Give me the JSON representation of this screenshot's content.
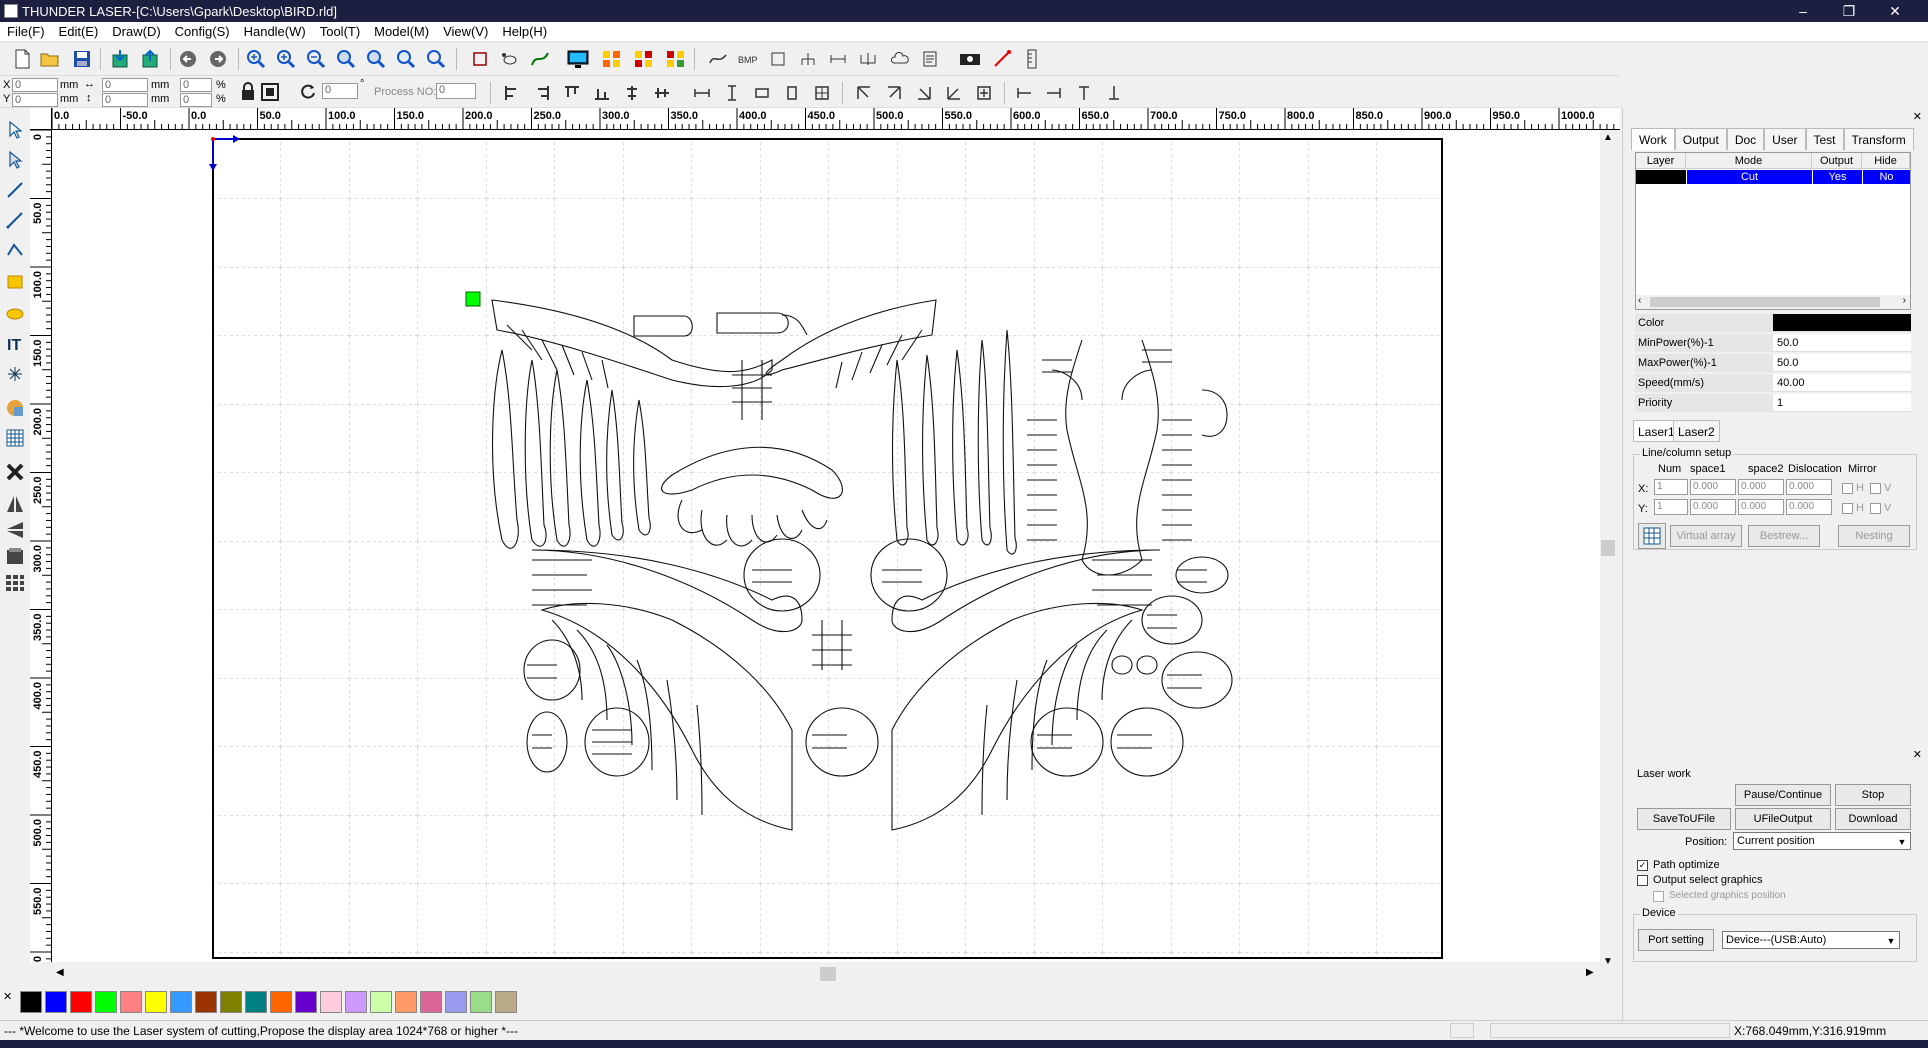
{
  "window": {
    "title": "THUNDER LASER-[C:\\Users\\Gpark\\Desktop\\BIRD.rld]",
    "min": "–",
    "max": "❐",
    "close": "✕"
  },
  "menu": [
    "File(F)",
    "Edit(E)",
    "Draw(D)",
    "Config(S)",
    "Handle(W)",
    "Tool(T)",
    "Model(M)",
    "View(V)",
    "Help(H)"
  ],
  "coords": {
    "x_label": "X",
    "y_label": "Y",
    "x_value": "0",
    "y_value": "0",
    "w_value": "0",
    "h_value": "0",
    "unit": "mm",
    "px_value": "0",
    "py_value": "0",
    "percent": "%",
    "rotate_value": "0",
    "degree": "°",
    "process_no_label": "Process NO:",
    "process_no_value": "0"
  },
  "ruler_h": [
    "0.0",
    "-50.0",
    "0.0",
    "50.0",
    "100.0",
    "150.0",
    "200.0",
    "250.0",
    "300.0",
    "350.0",
    "400.0",
    "450.0",
    "500.0",
    "550.0",
    "600.0",
    "650.0",
    "700.0",
    "750.0",
    "800.0",
    "850.0",
    "900.0",
    "950.0",
    "1000.0"
  ],
  "ruler_v": [
    "0",
    "50.0",
    "100.0",
    "150.0",
    "200.0",
    "250.0",
    "300.0",
    "350.0",
    "400.0",
    "450.0",
    "500.0",
    "550.0",
    "600.0"
  ],
  "panel": {
    "tabs": [
      "Work",
      "Output",
      "Doc",
      "User",
      "Test",
      "Transform"
    ],
    "layer_headers": [
      "Layer",
      "Mode",
      "Output",
      "Hide"
    ],
    "layer_row": {
      "mode": "Cut",
      "output": "Yes",
      "hide": "No"
    },
    "properties": [
      {
        "label": "Color",
        "value": ""
      },
      {
        "label": "MinPower(%)-1",
        "value": "50.0"
      },
      {
        "label": "MaxPower(%)-1",
        "value": "50.0"
      },
      {
        "label": "Speed(mm/s)",
        "value": "40.00"
      },
      {
        "label": "Priority",
        "value": "1"
      }
    ],
    "laser_tabs": [
      "Laser1",
      "Laser2"
    ],
    "array": {
      "title": "Line/column setup",
      "headers": [
        "Num",
        "space1",
        "space2",
        "Dislocation",
        "Mirror"
      ],
      "x_label": "X:",
      "y_label": "Y:",
      "num": "1",
      "space": "0.000",
      "h": "H",
      "v": "V",
      "virtual_array": "Virtual array",
      "bestrew": "Bestrew...",
      "nesting": "Nesting"
    },
    "laser_work": {
      "title": "Laser work",
      "pause": "Pause/Continue",
      "stop": "Stop",
      "save_to_file": "SaveToUFile",
      "ufile_output": "UFileOutput",
      "download": "Download",
      "position_label": "Position:",
      "position_value": "Current position",
      "path_optimize": "Path optimize",
      "output_select": "Output select graphics",
      "selected_position": "Selected graphics position"
    },
    "device": {
      "title": "Device",
      "port_setting": "Port setting",
      "device_value": "Device---(USB:Auto)"
    }
  },
  "palette": [
    "#000000",
    "#0000ff",
    "#ff0000",
    "#00ff00",
    "#ff8080",
    "#ffff00",
    "#3399ff",
    "#993300",
    "#808000",
    "#008080",
    "#ff6600",
    "#6600cc",
    "#ffccdd",
    "#cc99ff",
    "#ccffaa",
    "#ff9966",
    "#dd6699",
    "#9999ee",
    "#99dd88",
    "#bbaa88"
  ],
  "status": {
    "message": "--- *Welcome to use the Laser system of cutting,Propose the display area 1024*768 or higher *---",
    "coords": "X:768.049mm,Y:316.919mm"
  },
  "colors": {
    "title_bg": "#1c1f3f",
    "selection": "#0000ff",
    "marker": "#00ff00"
  }
}
